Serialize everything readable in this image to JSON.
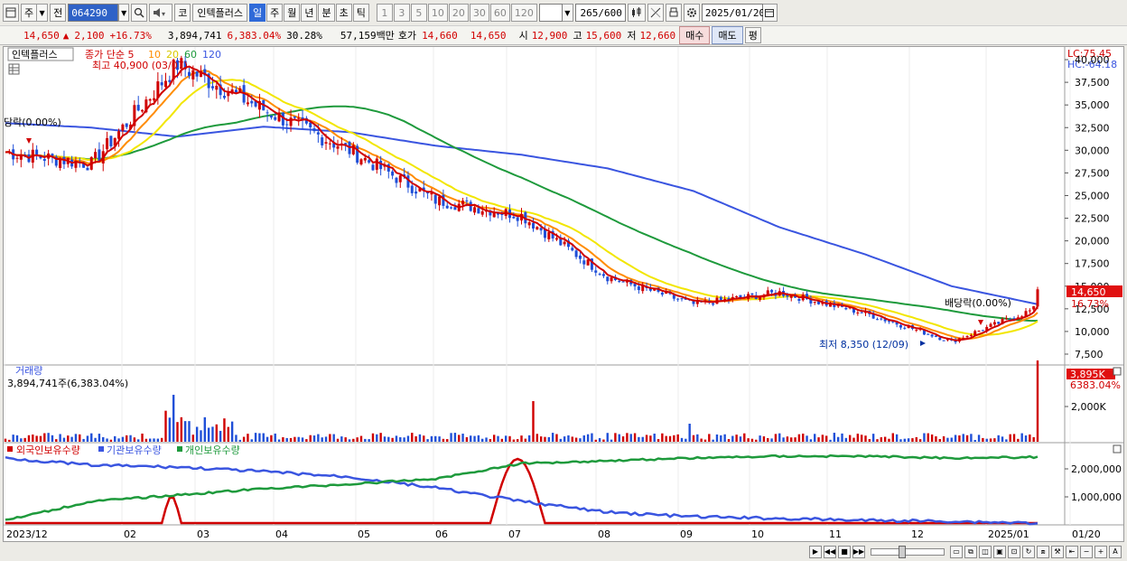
{
  "toolbar": {
    "period_type": "주",
    "prev_label": "전",
    "stock_code": "064290",
    "market_badge": "코",
    "stock_name": "인텍플러스",
    "periods": [
      {
        "label": "일",
        "selected": true
      },
      {
        "label": "주",
        "selected": false
      },
      {
        "label": "월",
        "selected": false
      },
      {
        "label": "년",
        "selected": false
      },
      {
        "label": "분",
        "selected": false
      },
      {
        "label": "초",
        "selected": false
      },
      {
        "label": "틱",
        "selected": false
      }
    ],
    "intervals": [
      "1",
      "3",
      "5",
      "10",
      "20",
      "30",
      "60",
      "120"
    ],
    "count_value": "265",
    "count_max": "/600",
    "date_value": "2025/01/20"
  },
  "quote": {
    "price": "14,650",
    "change_arrow": "▲",
    "change": "2,100",
    "change_pct": "+16.73%",
    "volume": "3,894,741",
    "volume_ratio": "6,383.04%",
    "turnover": "30.28%",
    "amount": "57,159백만",
    "bid_label": "호가",
    "ask_price": "14,660",
    "bid_price": "14,650",
    "open_label": "시",
    "open": "12,900",
    "high_label": "고",
    "high": "15,600",
    "low_label": "저",
    "low": "12,660",
    "buy_button": "매수",
    "sell_button": "매도",
    "eval_button": "평"
  },
  "chart": {
    "price_panel": {
      "legend_name": "인텍플러스",
      "legend_ma": "종가 단순 5",
      "ma_labels": [
        "10",
        "20",
        "60",
        "120"
      ],
      "high_annotation": "최고 40,900 (03/07)",
      "low_annotation": "최저 8,350 (12/09)",
      "dividend_left": "당락(0.00%)",
      "dividend_right": "배당락(0.00%)",
      "lc_label": "LC:75.45",
      "hc_label": "HC:-64.18",
      "y_ticks": [
        "40,000",
        "37,500",
        "35,000",
        "32,500",
        "30,000",
        "27,500",
        "25,000",
        "22,500",
        "20,000",
        "17,500",
        "15,000",
        "12,500",
        "10,000",
        "7,500"
      ],
      "current_price_badge": "14,650",
      "current_pct_badge": "16.73%",
      "colors": {
        "ma5": "#d00000",
        "ma10": "#ff8c00",
        "ma20": "#f2e600",
        "ma60": "#1e9a3c",
        "ma120": "#3a55e0",
        "up": "#d00000",
        "down": "#1f4fd8"
      }
    },
    "volume_panel": {
      "title": "거래량",
      "value_label": "3,894,741주(6,383.04%)",
      "badge_value": "3,895K",
      "badge_pct": "6383.04%",
      "y_ticks": [
        "2,000K"
      ]
    },
    "holdings_panel": {
      "legend": [
        {
          "label": "외국인보유수량",
          "color": "#d00000"
        },
        {
          "label": "기관보유수량",
          "color": "#3a55e0"
        },
        {
          "label": "개인보유수량",
          "color": "#1e9a3c"
        }
      ],
      "y_ticks": [
        "2,000,000",
        "1,000,000"
      ]
    },
    "x_labels": [
      "2023/12",
      "02",
      "03",
      "04",
      "05",
      "06",
      "07",
      "08",
      "09",
      "10",
      "11",
      "12",
      "2025/01",
      "01/20"
    ]
  },
  "chart_data": {
    "type": "line",
    "title": "",
    "x": [
      "2023/12",
      "02",
      "03",
      "04",
      "05",
      "06",
      "07",
      "08",
      "09",
      "10",
      "11",
      "12",
      "2025/01"
    ],
    "series": [
      {
        "name": "종가 단순 5",
        "values": [
          29800,
          28500,
          39500,
          34500,
          30000,
          24500,
          22800,
          16000,
          13000,
          14300,
          12000,
          8900,
          12600
        ]
      },
      {
        "name": "120",
        "values": [
          33000,
          32500,
          31500,
          32600,
          32000,
          30500,
          29500,
          28000,
          25500,
          21500,
          18500,
          15000,
          13000
        ]
      }
    ],
    "ylim": [
      7000,
      41000
    ],
    "y_ticks": [
      7500,
      10000,
      12500,
      15000,
      17500,
      20000,
      22500,
      25000,
      27500,
      30000,
      32500,
      35000,
      37500,
      40000
    ]
  }
}
